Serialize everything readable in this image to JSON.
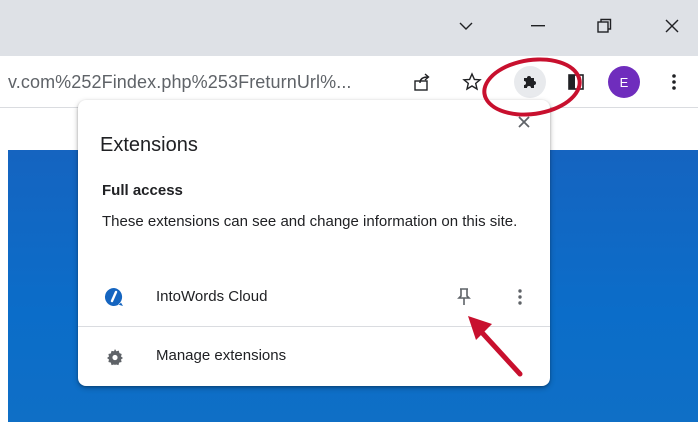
{
  "titlebar": {
    "controls": [
      {
        "name": "tab-search-button",
        "icon": "chevron-down-icon"
      },
      {
        "name": "minimize-button",
        "icon": "minimize-icon"
      },
      {
        "name": "restore-button",
        "icon": "restore-icon"
      },
      {
        "name": "close-button",
        "icon": "close-icon"
      }
    ]
  },
  "toolbar": {
    "url_text": "v.com%252Findex.php%253FreturnUrl%...",
    "icons": [
      "share-icon",
      "star-icon",
      "puzzle-icon",
      "sidepanel-icon",
      "kebab-menu-icon"
    ],
    "avatar_letter": "E",
    "avatar_color": "#6f2dbd"
  },
  "popup": {
    "title": "Extensions",
    "section_title": "Full access",
    "section_desc": "These extensions can see and change information on this site.",
    "extension": {
      "name": "IntoWords Cloud",
      "icon": "intowords-logo-icon"
    },
    "manage_label": "Manage extensions"
  },
  "colors": {
    "accent_blue": "#1565c0",
    "annotation_red": "#c8102e",
    "titlebar_bg": "#dee1e6"
  }
}
